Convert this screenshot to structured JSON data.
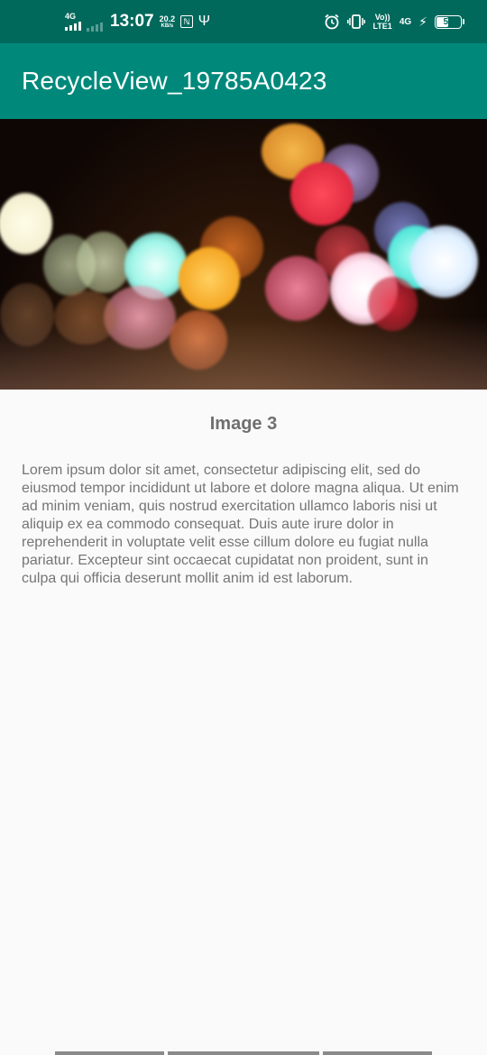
{
  "status_bar": {
    "network_label": "4G",
    "time": "13:07",
    "speed_value": "20.2",
    "speed_unit": "KB/s",
    "volte_top": "Vo))",
    "volte_bottom": "LTE1",
    "network2_label": "4G",
    "battery_level": "51",
    "icons": [
      "signal-icon",
      "usb-icon",
      "alarm-icon",
      "vibrate-icon",
      "charging-icon",
      "battery-icon"
    ]
  },
  "app_bar": {
    "title": "RecycleView_19785A0423",
    "color": "#00897b"
  },
  "item": {
    "image_description": "bokeh-city-lights",
    "caption": "Image 3",
    "text": "Lorem ipsum dolor sit amet, consectetur adipiscing elit, sed do eiusmod tempor incididunt ut labore et dolore magna aliqua. Ut enim ad minim veniam, quis nostrud exercitation ullamco laboris nisi ut aliquip ex ea commodo consequat. Duis aute irure dolor in reprehenderit in voluptate velit esse cillum dolore eu fugiat nulla pariatur. Excepteur sint occaecat cupidatat non proident, sunt in culpa qui officia deserunt mollit anim id est laborum."
  },
  "colors": {
    "status_bar": "#00695c",
    "accent": "#00897b",
    "background": "#fafafa",
    "text_secondary": "#757575"
  }
}
